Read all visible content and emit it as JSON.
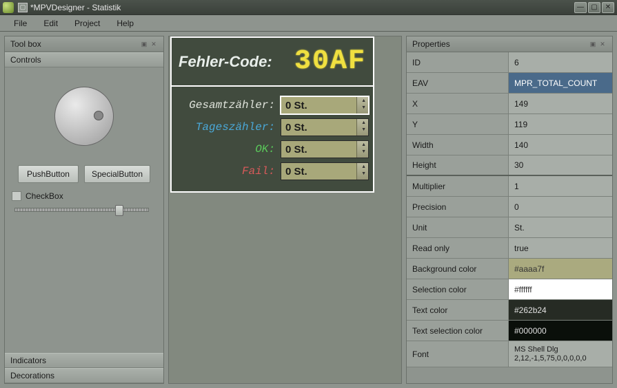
{
  "window": {
    "title": "*MPVDesigner - Statistik"
  },
  "menu": {
    "file": "File",
    "edit": "Edit",
    "project": "Project",
    "help": "Help"
  },
  "toolbox": {
    "title": "Tool box",
    "sections": {
      "controls": "Controls",
      "indicators": "Indicators",
      "decorations": "Decorations"
    },
    "push_button": "PushButton",
    "special_button": "SpecialButton",
    "checkbox": "CheckBox"
  },
  "canvas": {
    "title_label": "Fehler-Code:",
    "title_value": "30AF",
    "fields": [
      {
        "label": "Gesamtzähler:",
        "value": "0 St.",
        "color": "white"
      },
      {
        "label": "Tageszähler:",
        "value": "0 St.",
        "color": "blue"
      },
      {
        "label": "OK:",
        "value": "0 St.",
        "color": "green"
      },
      {
        "label": "Fail:",
        "value": "0 St.",
        "color": "red"
      }
    ]
  },
  "properties": {
    "title": "Properties",
    "rows": {
      "id_k": "ID",
      "id_v": "6",
      "eav_k": "EAV",
      "eav_v": "MPR_TOTAL_COUNT",
      "x_k": "X",
      "x_v": "149",
      "y_k": "Y",
      "y_v": "119",
      "w_k": "Width",
      "w_v": "140",
      "h_k": "Height",
      "h_v": "30",
      "mult_k": "Multiplier",
      "mult_v": "1",
      "prec_k": "Precision",
      "prec_v": "0",
      "unit_k": "Unit",
      "unit_v": "St.",
      "ro_k": "Read only",
      "ro_v": "true",
      "bg_k": "Background color",
      "bg_v": "#aaaa7f",
      "sel_k": "Selection color",
      "sel_v": "#ffffff",
      "tc_k": "Text color",
      "tc_v": "#262b24",
      "tsc_k": "Text selection color",
      "tsc_v": "#000000",
      "font_k": "Font",
      "font_v": "MS Shell Dlg 2,12,-1,5,75,0,0,0,0,0"
    }
  }
}
